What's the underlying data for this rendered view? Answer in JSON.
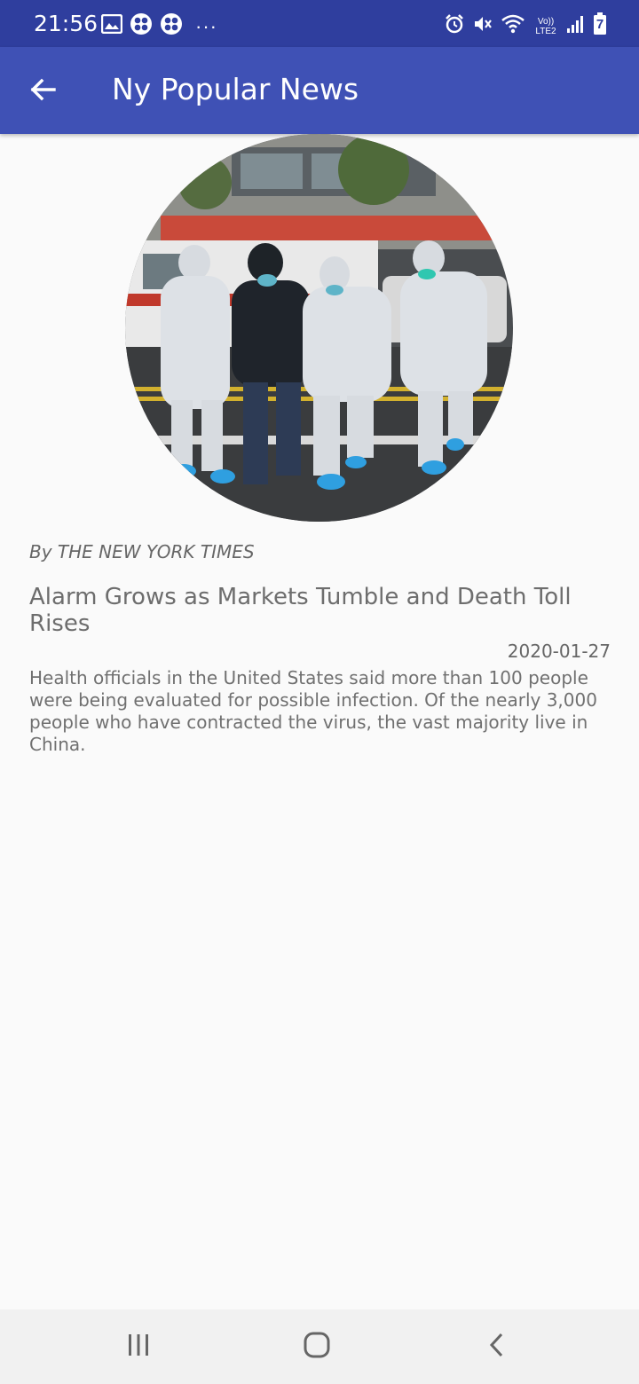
{
  "status_bar": {
    "time": "21:56",
    "more_indicator": "···",
    "network_label": "Vo)) LTE2",
    "battery_level": "7",
    "icons": [
      "gallery-icon",
      "app-notification-icon",
      "app-notification-icon",
      "more-notifications-icon",
      "alarm-icon",
      "mute-icon",
      "wifi-icon",
      "signal-icon",
      "battery-icon"
    ]
  },
  "app_bar": {
    "title": "Ny Popular News",
    "back_icon": "arrow-back-icon",
    "color": "#3f51b5"
  },
  "article": {
    "image_alt": "Medical workers in protective suits escorting a man on a street",
    "byline": "By THE NEW YORK TIMES",
    "title": "Alarm Grows as Markets Tumble and Death Toll Rises",
    "date": "2020-01-27",
    "abstract": "Health officials in the United States said more than 100 people were being evaluated for possible infection. Of the nearly 3,000 people who have contracted the virus, the vast majority live in China."
  },
  "nav_bar": {
    "buttons": [
      "recent-apps-icon",
      "home-icon",
      "back-icon"
    ]
  }
}
